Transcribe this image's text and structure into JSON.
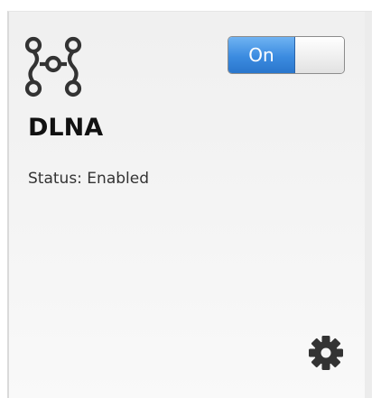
{
  "service": {
    "icon": "network-nodes-icon",
    "name": "DLNA",
    "status_label": "Status: Enabled"
  },
  "toggle": {
    "state": "on",
    "label": "On"
  },
  "settings": {
    "icon": "gear-icon"
  },
  "colors": {
    "toggle_on": "#3b8be0",
    "card_background": "#f2f2f2",
    "text": "#111111"
  }
}
